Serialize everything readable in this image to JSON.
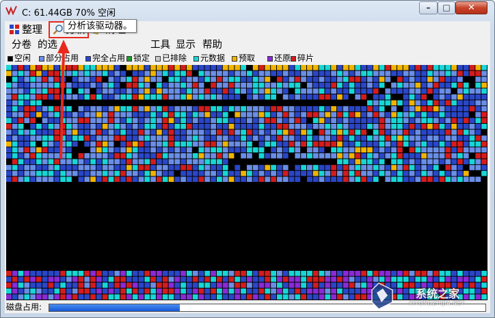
{
  "window": {
    "title": "C:  61.44GB 70% 空闲"
  },
  "toolbar": {
    "defrag_label": "整理",
    "analyze_label": "分析",
    "clean_label": "清理"
  },
  "menubar": {
    "items": [
      "分卷",
      "的选",
      "工具",
      "显示",
      "帮助"
    ]
  },
  "tooltip": {
    "text": "分析该驱动器。"
  },
  "legend": {
    "items": [
      {
        "label": "空闲",
        "color": "#000000"
      },
      {
        "label": "部分占用",
        "color": "#6a8ee6"
      },
      {
        "label": "完全占用",
        "color": "#2a46c8"
      },
      {
        "label": "锁定",
        "color": "#1e9e2e"
      },
      {
        "label": "已排除",
        "color": "#c8c8c8"
      },
      {
        "label": "元数据",
        "color": "#18d6d6"
      },
      {
        "label": "预取",
        "color": "#f0b400"
      },
      {
        "label": "还原",
        "color": "#8a2ad6"
      },
      {
        "label": "碎片",
        "color": "#d41c1c"
      }
    ]
  },
  "status": {
    "label": "磁盘占用:"
  },
  "disk_usage": {
    "fraction": 0.3
  },
  "watermark": {
    "text": "系统之家",
    "sub": "XITONGZHIJIA.NET"
  },
  "icons": [
    "app-logo-icon",
    "minimize-icon",
    "maximize-icon",
    "close-icon",
    "defrag-icon",
    "analyze-magnifier-icon",
    "clean-brush-icon"
  ]
}
